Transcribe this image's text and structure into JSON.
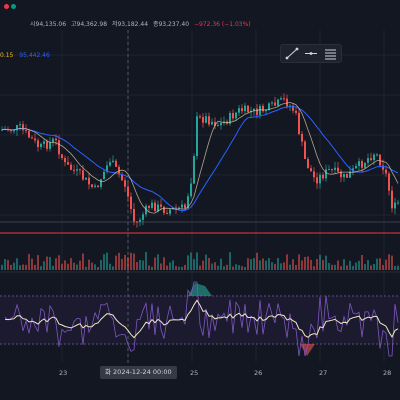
{
  "header": {
    "ohlc_tokens": [
      "시94,135.06",
      "고94,362.98",
      "저93,182.44",
      "종93,237.40",
      "−972.36 (−1.03%)"
    ],
    "ma_tokens": [
      "0.15",
      "95,442.46"
    ]
  },
  "colors": {
    "background": "#131722",
    "up": "#26a69a",
    "down": "#ef5350",
    "ma_blue": "#2962ff",
    "ma_beige": "#d7c9a8",
    "oscillator_line": "#7e57c2",
    "oscillator_signal": "#f0e6c8",
    "support_line": "#f23645"
  },
  "toolbar": {
    "icons": [
      "line-draw-icon",
      "arrow-line-icon",
      "list-icon"
    ]
  },
  "x_axis": {
    "labels": [
      {
        "text": "23"
      },
      {
        "text": "25"
      },
      {
        "text": "26"
      },
      {
        "text": "27"
      },
      {
        "text": "28"
      }
    ],
    "crosshair_label": "화 2024-12-24  00:00"
  }
}
